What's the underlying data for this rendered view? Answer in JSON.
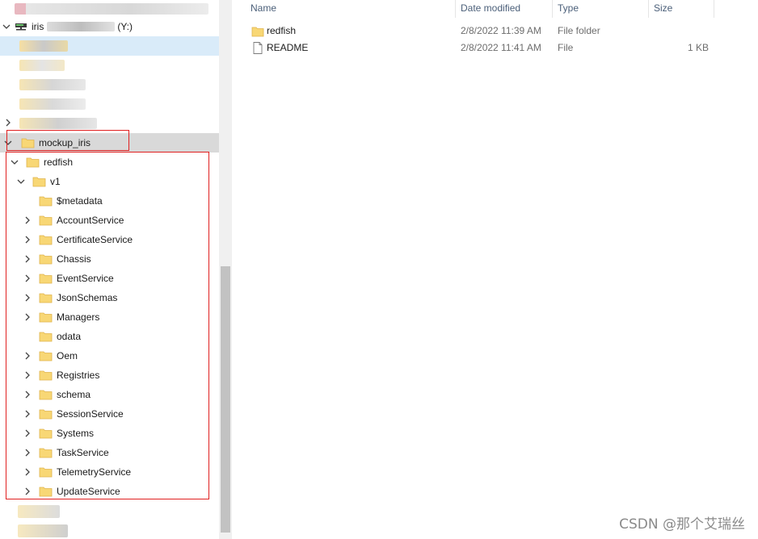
{
  "navigation": {
    "drive": {
      "label_prefix": "iris",
      "label_suffix": "(Y:)"
    },
    "highlighted_folder": "mockup_iris",
    "tree": [
      {
        "label": "redfish",
        "expanded": true
      },
      {
        "label": "v1",
        "expanded": true
      },
      {
        "label": "$metadata",
        "expandable": false
      },
      {
        "label": "AccountService",
        "expandable": true
      },
      {
        "label": "CertificateService",
        "expandable": true
      },
      {
        "label": "Chassis",
        "expandable": true
      },
      {
        "label": "EventService",
        "expandable": true
      },
      {
        "label": "JsonSchemas",
        "expandable": true
      },
      {
        "label": "Managers",
        "expandable": true
      },
      {
        "label": "odata",
        "expandable": false
      },
      {
        "label": "Oem",
        "expandable": true
      },
      {
        "label": "Registries",
        "expandable": true
      },
      {
        "label": "schema",
        "expandable": true
      },
      {
        "label": "SessionService",
        "expandable": true
      },
      {
        "label": "Systems",
        "expandable": true
      },
      {
        "label": "TaskService",
        "expandable": true
      },
      {
        "label": "TelemetryService",
        "expandable": true
      },
      {
        "label": "UpdateService",
        "expandable": true
      }
    ]
  },
  "file_list": {
    "columns": {
      "name": "Name",
      "date_modified": "Date modified",
      "type": "Type",
      "size": "Size"
    },
    "rows": [
      {
        "name": "redfish",
        "date_modified": "2/8/2022 11:39 AM",
        "type": "File folder",
        "size": "",
        "icon": "folder-icon"
      },
      {
        "name": "README",
        "date_modified": "2/8/2022 11:41 AM",
        "type": "File",
        "size": "1 KB",
        "icon": "file-icon"
      }
    ]
  },
  "watermark": "CSDN @那个艾瑞丝",
  "colors": {
    "highlight_box": "#e02020",
    "folder_yellow": "#f8d775",
    "selected_row": "#d9ebf9",
    "hover_row": "#d9d9d9"
  }
}
